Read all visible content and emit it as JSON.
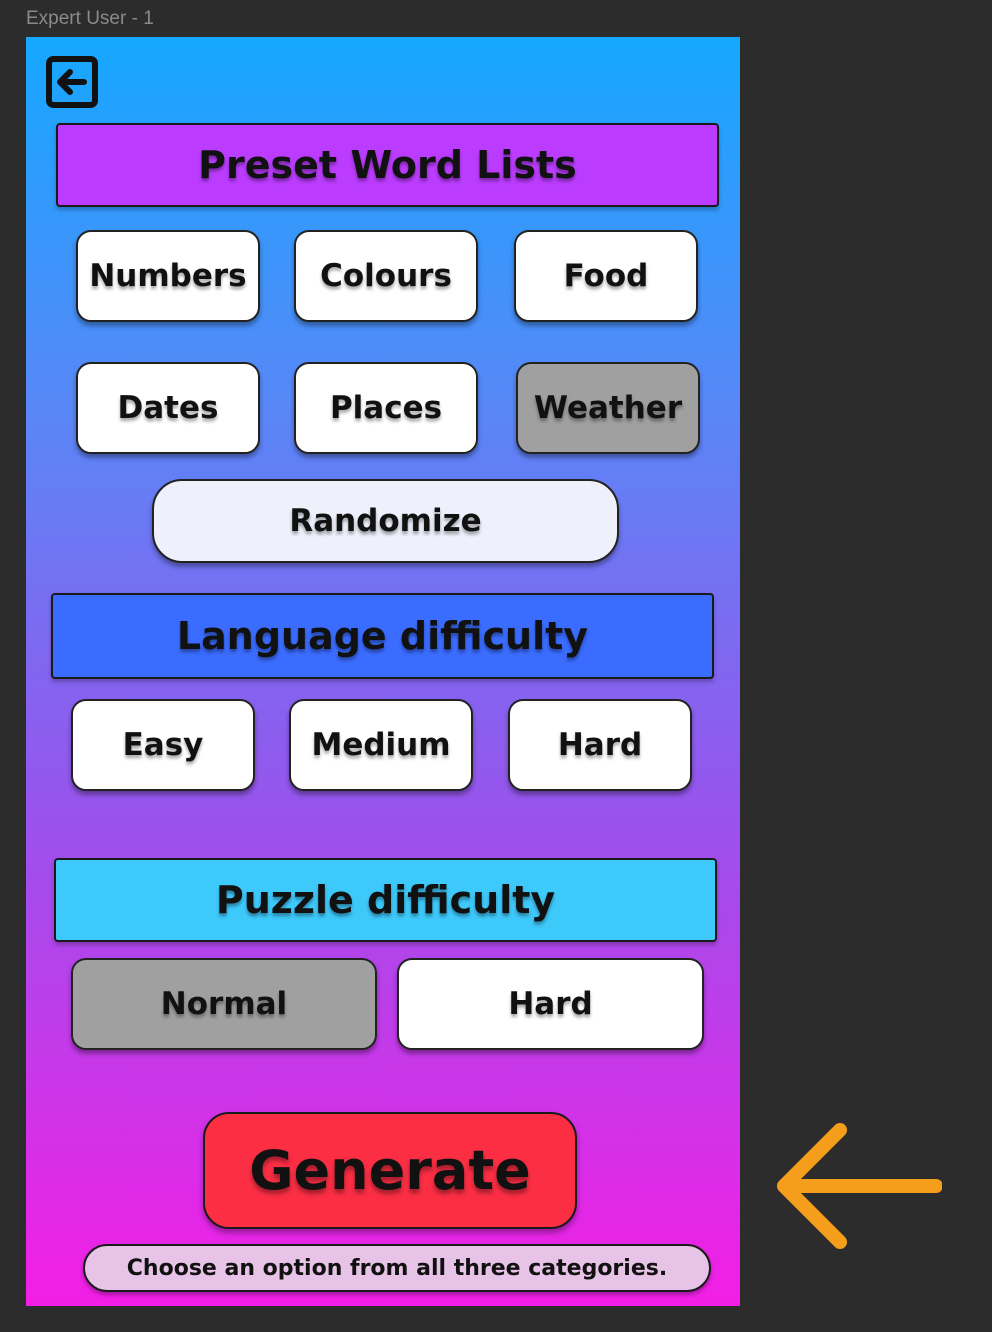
{
  "frame_label": "Expert User - 1",
  "back_button": {
    "icon": "exit-arrow-icon"
  },
  "preset_word_lists": {
    "title": "Preset Word Lists",
    "color": "#bb3cff",
    "options": [
      {
        "label": "Numbers",
        "selected": false
      },
      {
        "label": "Colours",
        "selected": false
      },
      {
        "label": "Food",
        "selected": false
      },
      {
        "label": "Dates",
        "selected": false
      },
      {
        "label": "Places",
        "selected": false
      },
      {
        "label": "Weather",
        "selected": true
      }
    ],
    "randomize_label": "Randomize"
  },
  "language_difficulty": {
    "title": "Language difficulty",
    "color": "#3a6cff",
    "options": [
      {
        "label": "Easy",
        "selected": false
      },
      {
        "label": "Medium",
        "selected": false
      },
      {
        "label": "Hard",
        "selected": false
      }
    ]
  },
  "puzzle_difficulty": {
    "title": "Puzzle difficulty",
    "color": "#3ec9fb",
    "options": [
      {
        "label": "Normal",
        "selected": true
      },
      {
        "label": "Hard",
        "selected": false
      }
    ]
  },
  "generate_label": "Generate",
  "hint_text": "Choose an option from all three categories.",
  "annotation_arrow": {
    "icon": "left-arrow-icon",
    "color": "#f59e1b"
  }
}
